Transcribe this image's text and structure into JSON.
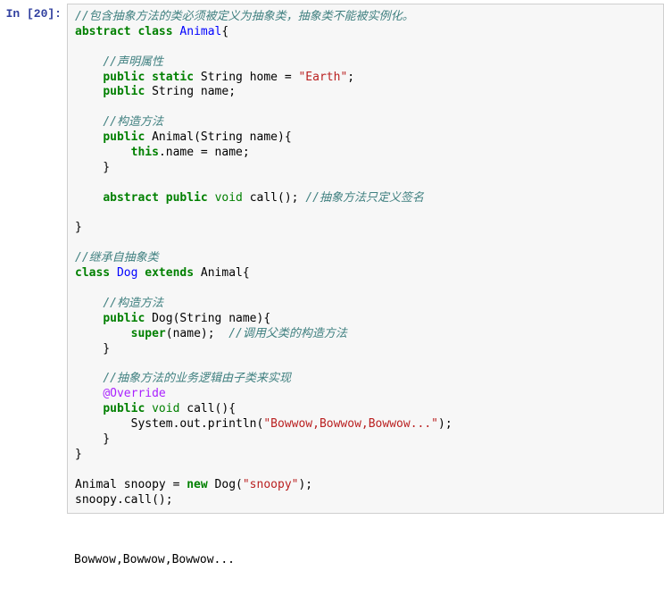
{
  "prompt": "In [20]:",
  "code": [
    {
      "t": "cm",
      "s": "//包含抽象方法的类必须被定义为抽象类，抽象类不能被实例化。"
    },
    {
      "t": "nl"
    },
    {
      "t": "kw",
      "s": "abstract"
    },
    {
      "t": "tx",
      "s": " "
    },
    {
      "t": "kw",
      "s": "class"
    },
    {
      "t": "tx",
      "s": " "
    },
    {
      "t": "nv",
      "s": "Animal"
    },
    {
      "t": "tx",
      "s": "{"
    },
    {
      "t": "nl"
    },
    {
      "t": "nl"
    },
    {
      "t": "tx",
      "s": "    "
    },
    {
      "t": "cm",
      "s": "//声明属性"
    },
    {
      "t": "nl"
    },
    {
      "t": "tx",
      "s": "    "
    },
    {
      "t": "kw",
      "s": "public"
    },
    {
      "t": "tx",
      "s": " "
    },
    {
      "t": "kw",
      "s": "static"
    },
    {
      "t": "tx",
      "s": " String home = "
    },
    {
      "t": "str",
      "s": "\"Earth\""
    },
    {
      "t": "tx",
      "s": ";"
    },
    {
      "t": "nl"
    },
    {
      "t": "tx",
      "s": "    "
    },
    {
      "t": "kw",
      "s": "public"
    },
    {
      "t": "tx",
      "s": " String name;"
    },
    {
      "t": "nl"
    },
    {
      "t": "nl"
    },
    {
      "t": "tx",
      "s": "    "
    },
    {
      "t": "cm",
      "s": "//构造方法"
    },
    {
      "t": "nl"
    },
    {
      "t": "tx",
      "s": "    "
    },
    {
      "t": "kw",
      "s": "public"
    },
    {
      "t": "tx",
      "s": " Animal(String name){"
    },
    {
      "t": "nl"
    },
    {
      "t": "tx",
      "s": "        "
    },
    {
      "t": "kw",
      "s": "this"
    },
    {
      "t": "tx",
      "s": ".name = name;"
    },
    {
      "t": "nl"
    },
    {
      "t": "tx",
      "s": "    }"
    },
    {
      "t": "nl"
    },
    {
      "t": "nl"
    },
    {
      "t": "tx",
      "s": "    "
    },
    {
      "t": "kw",
      "s": "abstract"
    },
    {
      "t": "tx",
      "s": " "
    },
    {
      "t": "kw",
      "s": "public"
    },
    {
      "t": "tx",
      "s": " "
    },
    {
      "t": "fn",
      "s": "void"
    },
    {
      "t": "tx",
      "s": " call(); "
    },
    {
      "t": "cm",
      "s": "//抽象方法只定义签名"
    },
    {
      "t": "nl"
    },
    {
      "t": "nl"
    },
    {
      "t": "tx",
      "s": "}"
    },
    {
      "t": "nl"
    },
    {
      "t": "nl"
    },
    {
      "t": "cm",
      "s": "//继承自抽象类"
    },
    {
      "t": "nl"
    },
    {
      "t": "kw",
      "s": "class"
    },
    {
      "t": "tx",
      "s": " "
    },
    {
      "t": "nv",
      "s": "Dog"
    },
    {
      "t": "tx",
      "s": " "
    },
    {
      "t": "kw",
      "s": "extends"
    },
    {
      "t": "tx",
      "s": " Animal{"
    },
    {
      "t": "nl"
    },
    {
      "t": "nl"
    },
    {
      "t": "tx",
      "s": "    "
    },
    {
      "t": "cm",
      "s": "//构造方法"
    },
    {
      "t": "nl"
    },
    {
      "t": "tx",
      "s": "    "
    },
    {
      "t": "kw",
      "s": "public"
    },
    {
      "t": "tx",
      "s": " Dog(String name){"
    },
    {
      "t": "nl"
    },
    {
      "t": "tx",
      "s": "        "
    },
    {
      "t": "kw",
      "s": "super"
    },
    {
      "t": "tx",
      "s": "(name);  "
    },
    {
      "t": "cm",
      "s": "//调用父类的构造方法"
    },
    {
      "t": "nl"
    },
    {
      "t": "tx",
      "s": "    }"
    },
    {
      "t": "nl"
    },
    {
      "t": "nl"
    },
    {
      "t": "tx",
      "s": "    "
    },
    {
      "t": "cm",
      "s": "//抽象方法的业务逻辑由子类来实现"
    },
    {
      "t": "nl"
    },
    {
      "t": "tx",
      "s": "    "
    },
    {
      "t": "dec",
      "s": "@Override"
    },
    {
      "t": "nl"
    },
    {
      "t": "tx",
      "s": "    "
    },
    {
      "t": "kw",
      "s": "public"
    },
    {
      "t": "tx",
      "s": " "
    },
    {
      "t": "fn",
      "s": "void"
    },
    {
      "t": "tx",
      "s": " call(){"
    },
    {
      "t": "nl"
    },
    {
      "t": "tx",
      "s": "        System.out.println("
    },
    {
      "t": "str",
      "s": "\"Bowwow,Bowwow,Bowwow...\""
    },
    {
      "t": "tx",
      "s": ");"
    },
    {
      "t": "nl"
    },
    {
      "t": "tx",
      "s": "    }"
    },
    {
      "t": "nl"
    },
    {
      "t": "tx",
      "s": "}"
    },
    {
      "t": "nl"
    },
    {
      "t": "nl"
    },
    {
      "t": "tx",
      "s": "Animal snoopy = "
    },
    {
      "t": "kw",
      "s": "new"
    },
    {
      "t": "tx",
      "s": " Dog("
    },
    {
      "t": "str",
      "s": "\"snoopy\""
    },
    {
      "t": "tx",
      "s": ");"
    },
    {
      "t": "nl"
    },
    {
      "t": "tx",
      "s": "snoopy.call();"
    }
  ],
  "output": "Bowwow,Bowwow,Bowwow...\n"
}
